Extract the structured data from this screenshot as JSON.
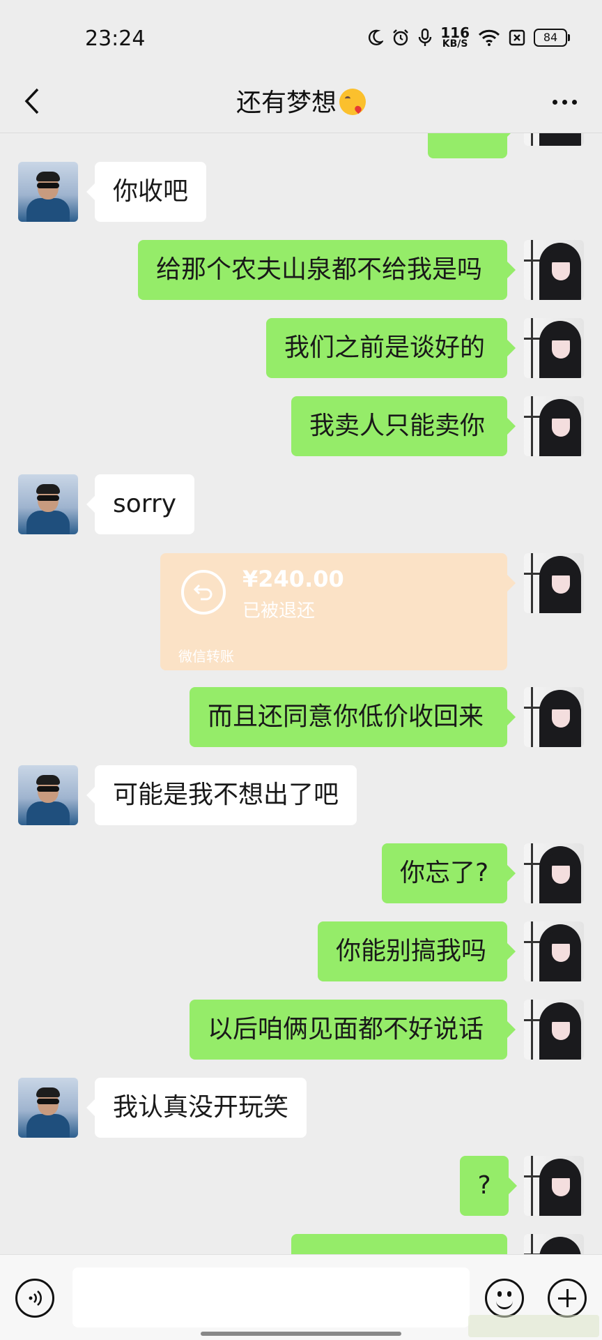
{
  "status_bar": {
    "time": "23:24",
    "net_speed_value": "116",
    "net_speed_unit": "KB/S",
    "battery": "84"
  },
  "header": {
    "title": "还有梦想",
    "title_emoji": "face-blowing-kiss"
  },
  "messages": [
    {
      "side": "right",
      "type": "text",
      "text": ""
    },
    {
      "side": "left",
      "type": "text",
      "text": "你收吧"
    },
    {
      "side": "right",
      "type": "text",
      "text": "给那个农夫山泉都不给我是吗"
    },
    {
      "side": "right",
      "type": "text",
      "text": "我们之前是谈好的"
    },
    {
      "side": "right",
      "type": "text",
      "text": "我卖人只能卖你"
    },
    {
      "side": "left",
      "type": "text",
      "text": "sorry"
    },
    {
      "side": "right",
      "type": "transfer",
      "amount": "¥240.00",
      "status": "已被退还",
      "label": "微信转账"
    },
    {
      "side": "right",
      "type": "text",
      "text": "而且还同意你低价收回来"
    },
    {
      "side": "left",
      "type": "text",
      "text": "可能是我不想出了吧"
    },
    {
      "side": "right",
      "type": "text",
      "text": "你忘了?"
    },
    {
      "side": "right",
      "type": "text",
      "text": "你能别搞我吗"
    },
    {
      "side": "right",
      "type": "text",
      "text": "以后咱俩见面都不好说话"
    },
    {
      "side": "left",
      "type": "text",
      "text": "我认真没开玩笑"
    },
    {
      "side": "right",
      "type": "text",
      "text": "?"
    }
  ],
  "input_bar": {
    "value": "",
    "voice_icon": "voice-icon",
    "emoji_icon": "emoji-icon",
    "plus_icon": "plus-icon"
  },
  "colors": {
    "background": "#ededed",
    "bubble_mine": "#95ec69",
    "bubble_theirs": "#ffffff",
    "transfer_returned": "#fbe2c6"
  }
}
